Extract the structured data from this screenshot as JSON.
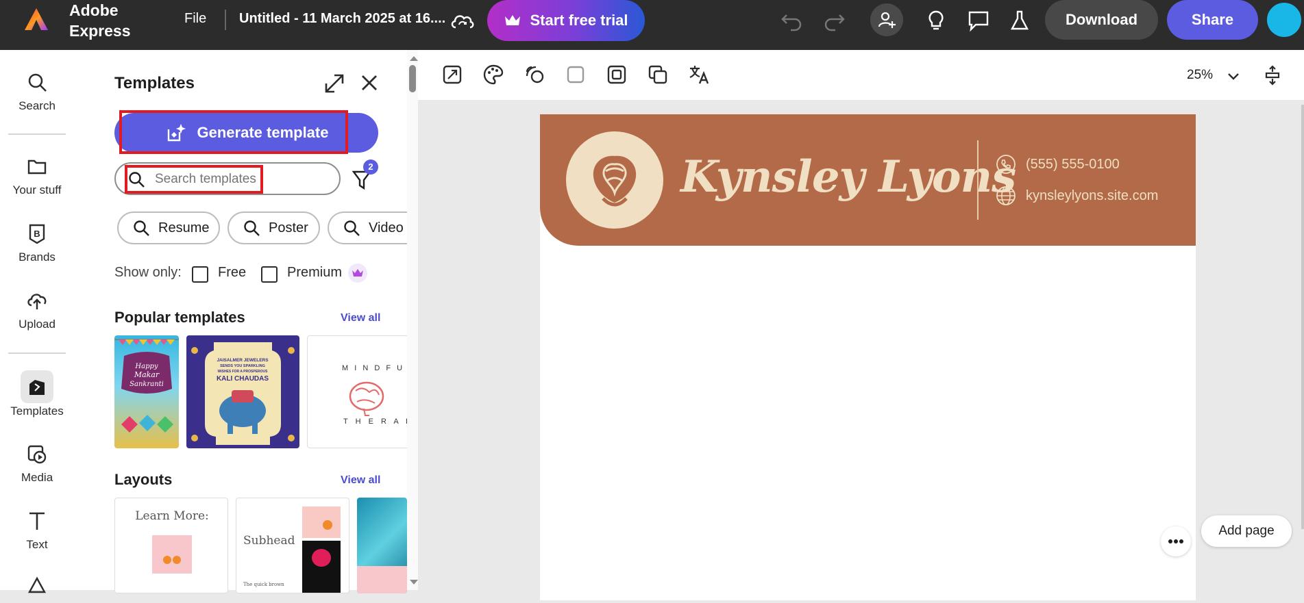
{
  "topbar": {
    "app_name": "Adobe Express",
    "file_label": "File",
    "doc_title": "Untitled - 11 March 2025 at 16....",
    "trial_label": "Start free trial",
    "download_label": "Download",
    "share_label": "Share"
  },
  "rail": {
    "items": [
      {
        "label": "Search",
        "icon": "search-icon"
      },
      {
        "label": "Your stuff",
        "icon": "folder-icon"
      },
      {
        "label": "Brands",
        "icon": "brand-icon"
      },
      {
        "label": "Upload",
        "icon": "upload-icon"
      },
      {
        "label": "Templates",
        "icon": "templates-icon"
      },
      {
        "label": "Media",
        "icon": "media-icon"
      },
      {
        "label": "Text",
        "icon": "text-icon"
      }
    ]
  },
  "panel": {
    "title": "Templates",
    "generate_label": "Generate template",
    "search_placeholder": "Search templates",
    "filter_count": "2",
    "chips": [
      "Resume",
      "Poster",
      "Video"
    ],
    "show_only_label": "Show only:",
    "free_label": "Free",
    "premium_label": "Premium",
    "popular_title": "Popular templates",
    "view_all": "View all",
    "layouts_title": "Layouts",
    "popular": [
      {
        "name": "makar-sankranti",
        "text": "Happy Makar Sankranti"
      },
      {
        "name": "kali-chaudas",
        "text": "JAISALMER JEWELERS SENDS YOU SPARKLING WISHES FOR A PROSPEROUS KALI CHAUDAS"
      },
      {
        "name": "mindfull-therapy",
        "text": "MINDFULL THERAPY"
      }
    ],
    "layouts": [
      {
        "name": "learn-more",
        "text": "Learn More:"
      },
      {
        "name": "subhead",
        "text": "Subhead",
        "sub": "The quick brown"
      },
      {
        "name": "ocean",
        "text": ""
      }
    ]
  },
  "canvas": {
    "zoom": "25%",
    "page": {
      "name": "Kynsley Lyons",
      "phone": "(555) 555-0100",
      "website": "kynsleylyons.site.com",
      "banner_color": "#b26a48",
      "accent_color": "#f0dfc2"
    },
    "add_page_label": "Add page"
  },
  "colors": {
    "brand": "#5c5ce0",
    "topbar": "#2c2c2c",
    "highlight": "#e11b22"
  }
}
